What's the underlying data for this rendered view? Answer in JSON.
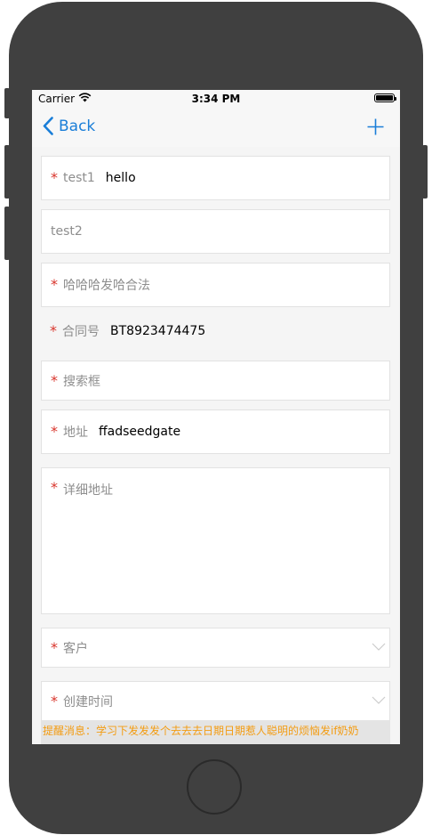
{
  "status_bar": {
    "carrier": "Carrier",
    "time": "3:34 PM"
  },
  "nav": {
    "back_label": "Back"
  },
  "form": {
    "test1": {
      "label": "test1",
      "value": "hello"
    },
    "test2": {
      "placeholder": "test2"
    },
    "hahaha": {
      "placeholder": "哈哈哈发哈合法"
    },
    "contract": {
      "label": "合同号",
      "value": "BT8923474475"
    },
    "search": {
      "placeholder": "搜索框"
    },
    "address": {
      "label": "地址",
      "value": "ffadseedgate"
    },
    "detail_address": {
      "placeholder": "详细地址"
    },
    "customer": {
      "label": "客户"
    },
    "created_time": {
      "label": "创建时间"
    }
  },
  "notice": {
    "text": "提醒消息：学习下发发发个去去去日期日期惹人聪明的烦恼发if奶奶"
  },
  "colors": {
    "accent": "#1a7ed8",
    "required": "#d9342b",
    "notice": "#f39c12"
  }
}
